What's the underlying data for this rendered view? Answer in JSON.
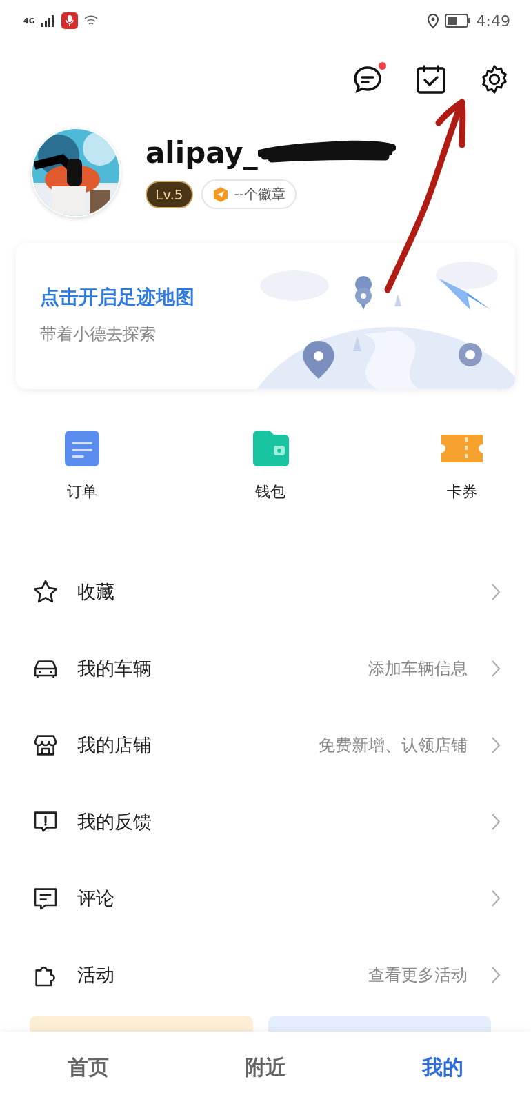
{
  "status_bar": {
    "network": "4G",
    "time": "4:49"
  },
  "header": {
    "messages_unread": true
  },
  "profile": {
    "username": "alipay_",
    "level": "Lv.5",
    "badges": "--个徽章"
  },
  "footprint_card": {
    "title": "点击开启足迹地图",
    "subtitle": "带着小德去探索"
  },
  "shortcuts": [
    {
      "label": "订单",
      "kind": "order"
    },
    {
      "label": "钱包",
      "kind": "wallet"
    },
    {
      "label": "卡券",
      "kind": "ticket"
    }
  ],
  "menu": [
    {
      "label": "收藏",
      "kind": "star"
    },
    {
      "label": "我的车辆",
      "kind": "car",
      "hint": "添加车辆信息"
    },
    {
      "label": "我的店铺",
      "kind": "shop",
      "hint": "免费新增、认领店铺"
    },
    {
      "label": "我的反馈",
      "kind": "feedback"
    },
    {
      "label": "评论",
      "kind": "comment"
    },
    {
      "label": "活动",
      "kind": "puzzle",
      "hint": "查看更多活动"
    }
  ],
  "tabs": [
    {
      "label": "首页",
      "selected": false
    },
    {
      "label": "附近",
      "selected": false
    },
    {
      "label": "我的",
      "selected": true
    }
  ]
}
